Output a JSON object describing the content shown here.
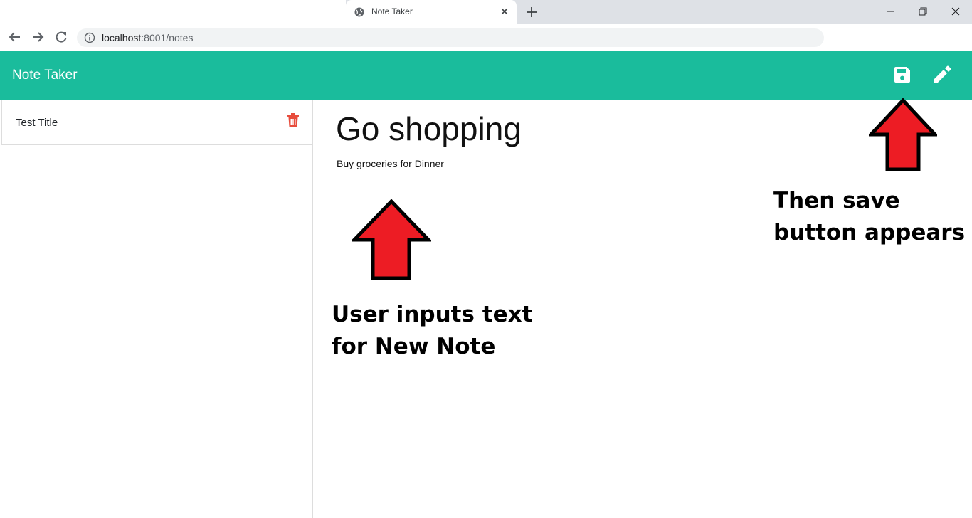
{
  "browser": {
    "tab_title": "Note Taker",
    "url_host": "localhost",
    "url_path": ":8001/notes"
  },
  "app": {
    "brand": "Note Taker",
    "brand_color": "#1abc9c",
    "icons": {
      "save": "save-icon",
      "edit": "pencil-icon",
      "delete": "trash-icon"
    }
  },
  "notes_list": [
    {
      "title": "Test Title"
    }
  ],
  "editor": {
    "title": "Go shopping",
    "text": "Buy groceries for Dinner"
  },
  "annotations": {
    "input_line1": "User inputs text",
    "input_line2": "for New Note",
    "save_line1": "Then save",
    "save_line2": "button appears",
    "arrow_color": "#ed1c24"
  }
}
